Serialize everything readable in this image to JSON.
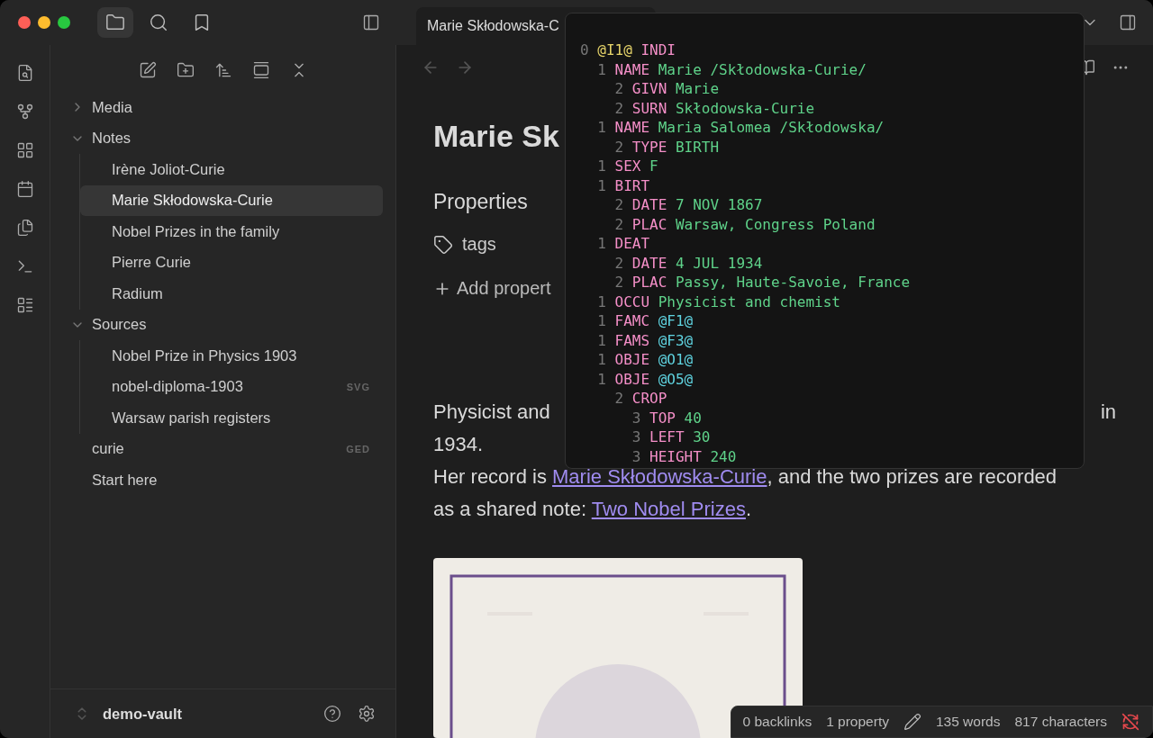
{
  "top_tabs": [
    {
      "kind": "files",
      "selected": true
    },
    {
      "kind": "search",
      "selected": false
    },
    {
      "kind": "bookmarks",
      "selected": false
    }
  ],
  "tab": {
    "title": "Marie Skłodowska-C"
  },
  "tree": [
    {
      "label": "Media",
      "expanded": false,
      "selected": false
    },
    {
      "label": "Notes",
      "expanded": true,
      "selected": false,
      "children": [
        {
          "label": "Irène Joliot-Curie",
          "selected": false
        },
        {
          "label": "Marie Skłodowska-Curie",
          "selected": true
        },
        {
          "label": "Nobel Prizes in the family",
          "selected": false
        },
        {
          "label": "Pierre Curie",
          "selected": false
        },
        {
          "label": "Radium",
          "selected": false
        }
      ]
    },
    {
      "label": "Sources",
      "expanded": true,
      "selected": false,
      "children": [
        {
          "label": "Nobel Prize in Physics 1903",
          "selected": false
        },
        {
          "label": "nobel-diploma-1903",
          "badge": "SVG",
          "selected": false
        },
        {
          "label": "Warsaw parish registers",
          "selected": false
        }
      ]
    },
    {
      "label": "curie",
      "badge": "GED",
      "selected": false
    },
    {
      "label": "Start here",
      "selected": false
    }
  ],
  "vault": {
    "name": "demo-vault"
  },
  "note": {
    "title": "Marie Sk",
    "properties_heading": "Properties",
    "property": "tags",
    "add_property": "Add propert",
    "line_start": "Physicist and",
    "line_end": "in",
    "line_2": "1934.",
    "sentence": [
      {
        "kind": "plain",
        "text": "Her record is "
      },
      {
        "kind": "link",
        "text": "Marie Skłodowska-Curie"
      },
      {
        "kind": "plain",
        "text": ", and the two prizes are recorded as a shared note: "
      },
      {
        "kind": "link",
        "text": "Two Nobel Prizes"
      },
      {
        "kind": "plain",
        "text": "."
      }
    ]
  },
  "popover": {
    "lines": [
      {
        "level": "0",
        "parts": [
          {
            "kind": "xref",
            "text": "@I1@"
          },
          {
            "kind": "tag",
            "text": "INDI"
          }
        ]
      },
      {
        "level": "1",
        "parts": [
          {
            "kind": "tag",
            "text": "NAME"
          },
          {
            "kind": "text",
            "text": "Marie /Skłodowska-Curie/"
          }
        ]
      },
      {
        "level": "2",
        "parts": [
          {
            "kind": "tag",
            "text": "GIVN"
          },
          {
            "kind": "text",
            "text": "Marie"
          }
        ]
      },
      {
        "level": "2",
        "parts": [
          {
            "kind": "tag",
            "text": "SURN"
          },
          {
            "kind": "text",
            "text": "Skłodowska-Curie"
          }
        ]
      },
      {
        "level": "1",
        "parts": [
          {
            "kind": "tag",
            "text": "NAME"
          },
          {
            "kind": "text",
            "text": "Maria Salomea /Skłodowska/"
          }
        ]
      },
      {
        "level": "2",
        "parts": [
          {
            "kind": "tag",
            "text": "TYPE"
          },
          {
            "kind": "text",
            "text": "BIRTH"
          }
        ]
      },
      {
        "level": "1",
        "parts": [
          {
            "kind": "tag",
            "text": "SEX"
          },
          {
            "kind": "text",
            "text": "F"
          }
        ]
      },
      {
        "level": "1",
        "parts": [
          {
            "kind": "tag",
            "text": "BIRT"
          }
        ]
      },
      {
        "level": "2",
        "parts": [
          {
            "kind": "tag",
            "text": "DATE"
          },
          {
            "kind": "text",
            "text": "7 NOV 1867"
          }
        ]
      },
      {
        "level": "2",
        "parts": [
          {
            "kind": "tag",
            "text": "PLAC"
          },
          {
            "kind": "text",
            "text": "Warsaw, Congress Poland"
          }
        ]
      },
      {
        "level": "1",
        "parts": [
          {
            "kind": "tag",
            "text": "DEAT"
          }
        ]
      },
      {
        "level": "2",
        "parts": [
          {
            "kind": "tag",
            "text": "DATE"
          },
          {
            "kind": "text",
            "text": "4 JUL 1934"
          }
        ]
      },
      {
        "level": "2",
        "parts": [
          {
            "kind": "tag",
            "text": "PLAC"
          },
          {
            "kind": "text",
            "text": "Passy, Haute-Savoie, France"
          }
        ]
      },
      {
        "level": "1",
        "parts": [
          {
            "kind": "tag",
            "text": "OCCU"
          },
          {
            "kind": "text",
            "text": "Physicist and chemist"
          }
        ]
      },
      {
        "level": "1",
        "parts": [
          {
            "kind": "tag",
            "text": "FAMC"
          },
          {
            "kind": "pointer",
            "text": "@F1@"
          }
        ]
      },
      {
        "level": "1",
        "parts": [
          {
            "kind": "tag",
            "text": "FAMS"
          },
          {
            "kind": "pointer",
            "text": "@F3@"
          }
        ]
      },
      {
        "level": "1",
        "parts": [
          {
            "kind": "tag",
            "text": "OBJE"
          },
          {
            "kind": "pointer",
            "text": "@O1@"
          }
        ]
      },
      {
        "level": "1",
        "parts": [
          {
            "kind": "tag",
            "text": "OBJE"
          },
          {
            "kind": "pointer",
            "text": "@O5@"
          }
        ]
      },
      {
        "level": "2",
        "parts": [
          {
            "kind": "tag",
            "text": "CROP"
          }
        ]
      },
      {
        "level": "3",
        "parts": [
          {
            "kind": "tag",
            "text": "TOP"
          },
          {
            "kind": "text",
            "text": "40"
          }
        ]
      },
      {
        "level": "3",
        "parts": [
          {
            "kind": "tag",
            "text": "LEFT"
          },
          {
            "kind": "text",
            "text": "30"
          }
        ]
      },
      {
        "level": "3",
        "parts": [
          {
            "kind": "tag",
            "text": "HEIGHT"
          },
          {
            "kind": "text",
            "text": "240"
          }
        ]
      }
    ]
  },
  "status_bar": {
    "backlinks": "0 backlinks",
    "properties": "1 property",
    "words": "135 words",
    "characters": "817 characters",
    "sync_error": true
  }
}
